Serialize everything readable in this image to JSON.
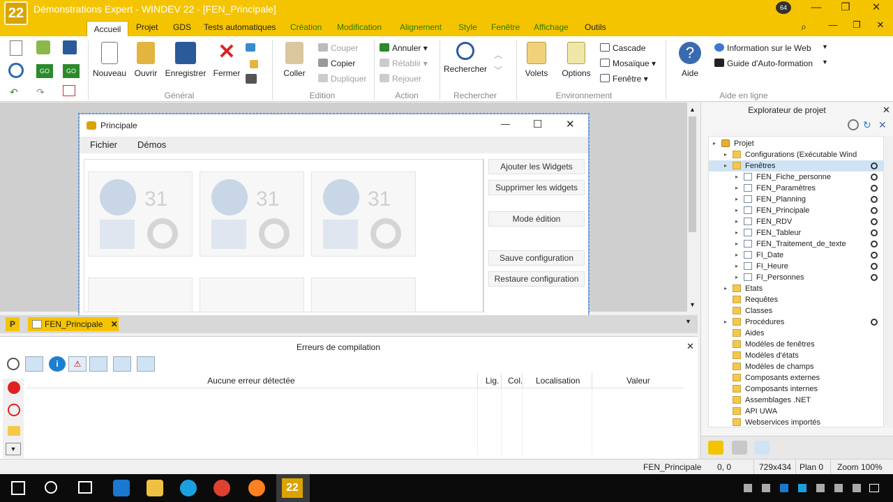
{
  "app": {
    "title": "Démonstrations Expert - WINDEV 22 - [FEN_Principale]",
    "logo_text": "22",
    "badge": "64",
    "window_controls": {
      "minimize": "—",
      "maximize": "❐",
      "close": "✕"
    }
  },
  "ribbon_tabs": [
    "Accueil",
    "Projet",
    "GDS",
    "Tests automatiques",
    "Création",
    "Modification",
    "Alignement",
    "Style",
    "Fenêtre",
    "Affichage",
    "Outils"
  ],
  "ribbon": {
    "general": {
      "label": "Général",
      "buttons": [
        "Nouveau",
        "Ouvrir",
        "Enregistrer",
        "Fermer"
      ]
    },
    "edition": {
      "label": "Edition",
      "paste": "Coller",
      "items": [
        "Couper",
        "Copier",
        "Dupliquer"
      ]
    },
    "action": {
      "label": "Action",
      "items": [
        "Annuler",
        "Rétablir",
        "Rejouer"
      ]
    },
    "rechercher": {
      "label": "Rechercher",
      "button": "Rechercher"
    },
    "environnement": {
      "label": "Environnement",
      "buttons": [
        "Volets",
        "Options"
      ],
      "items": [
        "Cascade",
        "Mosaïque",
        "Fenêtre"
      ]
    },
    "aide": {
      "label": "Aide en ligne",
      "button": "Aide",
      "items": [
        "Information sur le Web",
        "Guide d'Auto-formation"
      ]
    }
  },
  "editor_window": {
    "title": "Principale",
    "menu": [
      "Fichier",
      "Démos"
    ],
    "widget_day": "31",
    "buttons": [
      "Ajouter les Widgets",
      "Supprimer les widgets",
      "Mode édition",
      "Sauve configuration",
      "Restaure configuration"
    ],
    "controls": {
      "minimize": "—",
      "maximize": "☐",
      "close": "✕"
    }
  },
  "doc_tab": {
    "label": "FEN_Principale",
    "close": "✕"
  },
  "errors_panel": {
    "title": "Erreurs de compilation",
    "columns": [
      "Aucune erreur détectée",
      "Lig.",
      "Col.",
      "Localisation",
      "Valeur"
    ]
  },
  "project_explorer": {
    "title": "Explorateur de projet",
    "items": [
      {
        "label": "Projet",
        "level": 0
      },
      {
        "label": "Configurations (Exécutable Wind",
        "level": 1
      },
      {
        "label": "Fenêtres",
        "level": 1,
        "selected": true
      },
      {
        "label": "FEN_Fiche_personne",
        "level": 2
      },
      {
        "label": "FEN_Paramètres",
        "level": 2
      },
      {
        "label": "FEN_Planning",
        "level": 2
      },
      {
        "label": "FEN_Principale",
        "level": 2
      },
      {
        "label": "FEN_RDV",
        "level": 2
      },
      {
        "label": "FEN_Tableur",
        "level": 2
      },
      {
        "label": "FEN_Traitement_de_texte",
        "level": 2
      },
      {
        "label": "FI_Date",
        "level": 2
      },
      {
        "label": "FI_Heure",
        "level": 2
      },
      {
        "label": "FI_Personnes",
        "level": 2
      },
      {
        "label": "Etats",
        "level": 1
      },
      {
        "label": "Requêtes",
        "level": 1
      },
      {
        "label": "Classes",
        "level": 1
      },
      {
        "label": "Procédures",
        "level": 1
      },
      {
        "label": "Aides",
        "level": 1
      },
      {
        "label": "Modèles de fenêtres",
        "level": 1
      },
      {
        "label": "Modèles d'états",
        "level": 1
      },
      {
        "label": "Modèles de champs",
        "level": 1
      },
      {
        "label": "Composants externes",
        "level": 1
      },
      {
        "label": "Composants internes",
        "level": 1
      },
      {
        "label": "Assemblages .NET",
        "level": 1
      },
      {
        "label": "API UWA",
        "level": 1
      },
      {
        "label": "Webservices importés",
        "level": 1
      }
    ]
  },
  "status": {
    "window": "FEN_Principale",
    "position": "0, 0",
    "size": "729x434",
    "plan": "Plan 0",
    "zoom": "Zoom 100%"
  },
  "taskbar": {
    "app_badge": "22"
  },
  "colors": {
    "accent": "#f5c400",
    "ribbon_green": "#2b7a00"
  }
}
